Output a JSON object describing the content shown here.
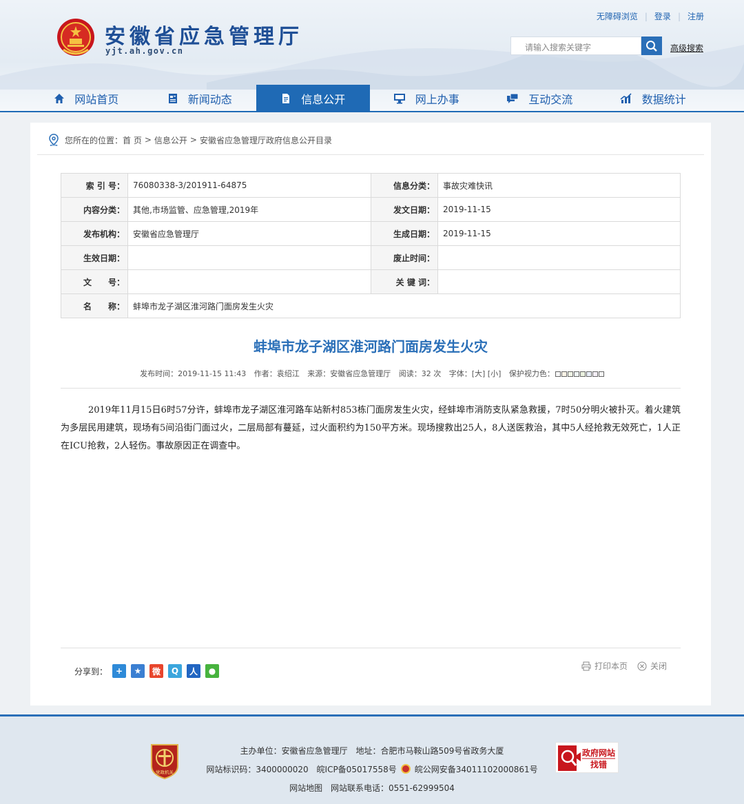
{
  "header": {
    "site_name": "安徽省应急管理厅",
    "domain": "yjt.ah.gov.cn",
    "links": [
      "无障碍浏览",
      "登录",
      "注册"
    ],
    "search_placeholder": "请输入搜索关键字",
    "advanced_search": "高级搜索"
  },
  "nav": [
    {
      "label": "网站首页",
      "icon": "home-icon"
    },
    {
      "label": "新闻动态",
      "icon": "news-icon"
    },
    {
      "label": "信息公开",
      "icon": "document-icon",
      "active": true
    },
    {
      "label": "网上办事",
      "icon": "monitor-icon"
    },
    {
      "label": "互动交流",
      "icon": "chat-icon"
    },
    {
      "label": "数据统计",
      "icon": "stats-icon"
    }
  ],
  "breadcrumb": {
    "prefix": "您所在的位置：",
    "items": [
      "首 页",
      "信息公开",
      "安徽省应急管理厅政府信息公开目录"
    ],
    "separator": ">"
  },
  "meta": {
    "index_no_label": "索 引 号：",
    "index_no": "76080338-3/201911-64875",
    "info_category_label": "信息分类：",
    "info_category": "事故灾难快讯",
    "content_category_label": "内容分类：",
    "content_category": "其他,市场监管、应急管理,2019年",
    "issue_date_label": "发文日期：",
    "issue_date": "2019-11-15",
    "publisher_label": "发布机构：",
    "publisher": "安徽省应急管理厅",
    "generated_date_label": "生成日期：",
    "generated_date": "2019-11-15",
    "effective_date_label": "生效日期：",
    "effective_date": "",
    "expiry_date_label": "废止时间：",
    "expiry_date": "",
    "doc_no_label": "文　　号：",
    "doc_no": "",
    "keywords_label": "关 键 词：",
    "keywords": "",
    "name_label": "名　　称：",
    "name": "蚌埠市龙子湖区淮河路门面房发生火灾"
  },
  "article": {
    "title": "蚌埠市龙子湖区淮河路门面房发生火灾",
    "publish_time": "发布时间：2019-11-15 11:43",
    "author": "作者：袁绍江",
    "source": "来源：安徽省应急管理厅",
    "reads": "阅读：32 次",
    "font_size": "字体：[大] [小]",
    "eye_care": "保护视力色：",
    "body": "2019年11月15日6时57分许，蚌埠市龙子湖区淮河路车站新村853栋门面房发生火灾，经蚌埠市消防支队紧急救援，7时50分明火被扑灭。着火建筑为多层民用建筑，现场有5间沿街门面过火，二层局部有蔓延，过火面积约为150平方米。现场搜救出25人，8人送医救治，其中5人经抢救无效死亡，1人正在ICU抢救，2人轻伤。事故原因正在调查中。"
  },
  "share": {
    "label": "分享到：",
    "icons": [
      "share-plus-icon",
      "qzone-icon",
      "weibo-icon",
      "tencent-weibo-icon",
      "renren-icon",
      "wechat-icon"
    ]
  },
  "tools": {
    "print": "打印本页",
    "close": "关闭"
  },
  "footer": {
    "line1_host": "主办单位：安徽省应急管理厅",
    "line1_addr": "地址：合肥市马鞍山路509号省政务大厦",
    "line2_id": "网站标识码：3400000020",
    "line2_icp": "皖ICP备05017558号",
    "line2_police": "皖公网安备34011102000861号",
    "line3_map": "网站地图",
    "line3_phone": "网站联系电话：0551-62999504",
    "badge_text": "党政机关",
    "gov_site_line1": "政府网站",
    "gov_site_line2": "找错"
  },
  "colors": {
    "brand_blue": "#1f6ab5",
    "title_blue": "#2a6fb8"
  }
}
